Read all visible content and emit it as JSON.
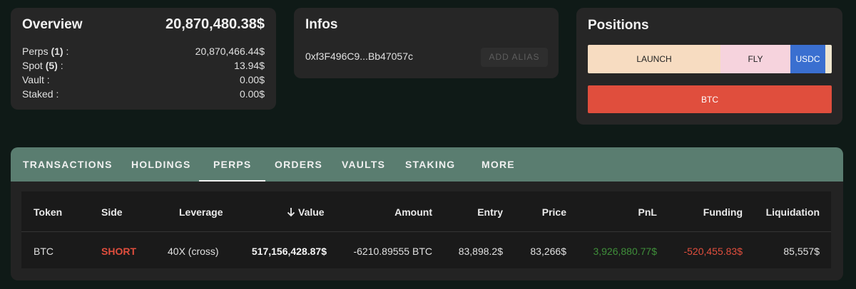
{
  "overview": {
    "title": "Overview",
    "total": "20,870,480.38$",
    "rows": [
      {
        "label_prefix": "Perps ",
        "count": "(1)",
        "label_suffix": " :",
        "value": "20,870,466.44$"
      },
      {
        "label_prefix": "Spot ",
        "count": "(5)",
        "label_suffix": " :",
        "value": "13.94$"
      },
      {
        "label_prefix": "Vault :",
        "count": "",
        "label_suffix": "",
        "value": "0.00$"
      },
      {
        "label_prefix": "Staked :",
        "count": "",
        "label_suffix": "",
        "value": "0.00$"
      }
    ]
  },
  "infos": {
    "title": "Infos",
    "address": "0xf3F496C9...Bb47057c",
    "add_alias_label": "ADD ALIAS"
  },
  "positions": {
    "title": "Positions",
    "segments": [
      {
        "label": "LAUNCH",
        "color": "#f7dcc1"
      },
      {
        "label": "FLY",
        "color": "#f6d3dd"
      },
      {
        "label": "USDC",
        "color": "#3a6fd0"
      }
    ],
    "btc_label": "BTC",
    "btc_color": "#e04e3d"
  },
  "tabs": [
    {
      "label": "TRANSACTIONS"
    },
    {
      "label": "HOLDINGS"
    },
    {
      "label": "PERPS",
      "active": true
    },
    {
      "label": "ORDERS"
    },
    {
      "label": "VAULTS"
    },
    {
      "label": "STAKING"
    },
    {
      "label": "MORE"
    }
  ],
  "table": {
    "headers": {
      "token": "Token",
      "side": "Side",
      "leverage": "Leverage",
      "value": "Value",
      "amount": "Amount",
      "entry": "Entry",
      "price": "Price",
      "pnl": "PnL",
      "funding": "Funding",
      "liquidation": "Liquidation"
    },
    "sort_icon": "arrow-down-icon",
    "rows": [
      {
        "token": "BTC",
        "side": "SHORT",
        "leverage": "40X (cross)",
        "value": "517,156,428.87$",
        "amount": "-6210.89555 BTC",
        "entry": "83,898.2$",
        "price": "83,266$",
        "pnl": "3,926,880.77$",
        "funding": "-520,455.83$",
        "liquidation": "85,557$"
      }
    ]
  }
}
